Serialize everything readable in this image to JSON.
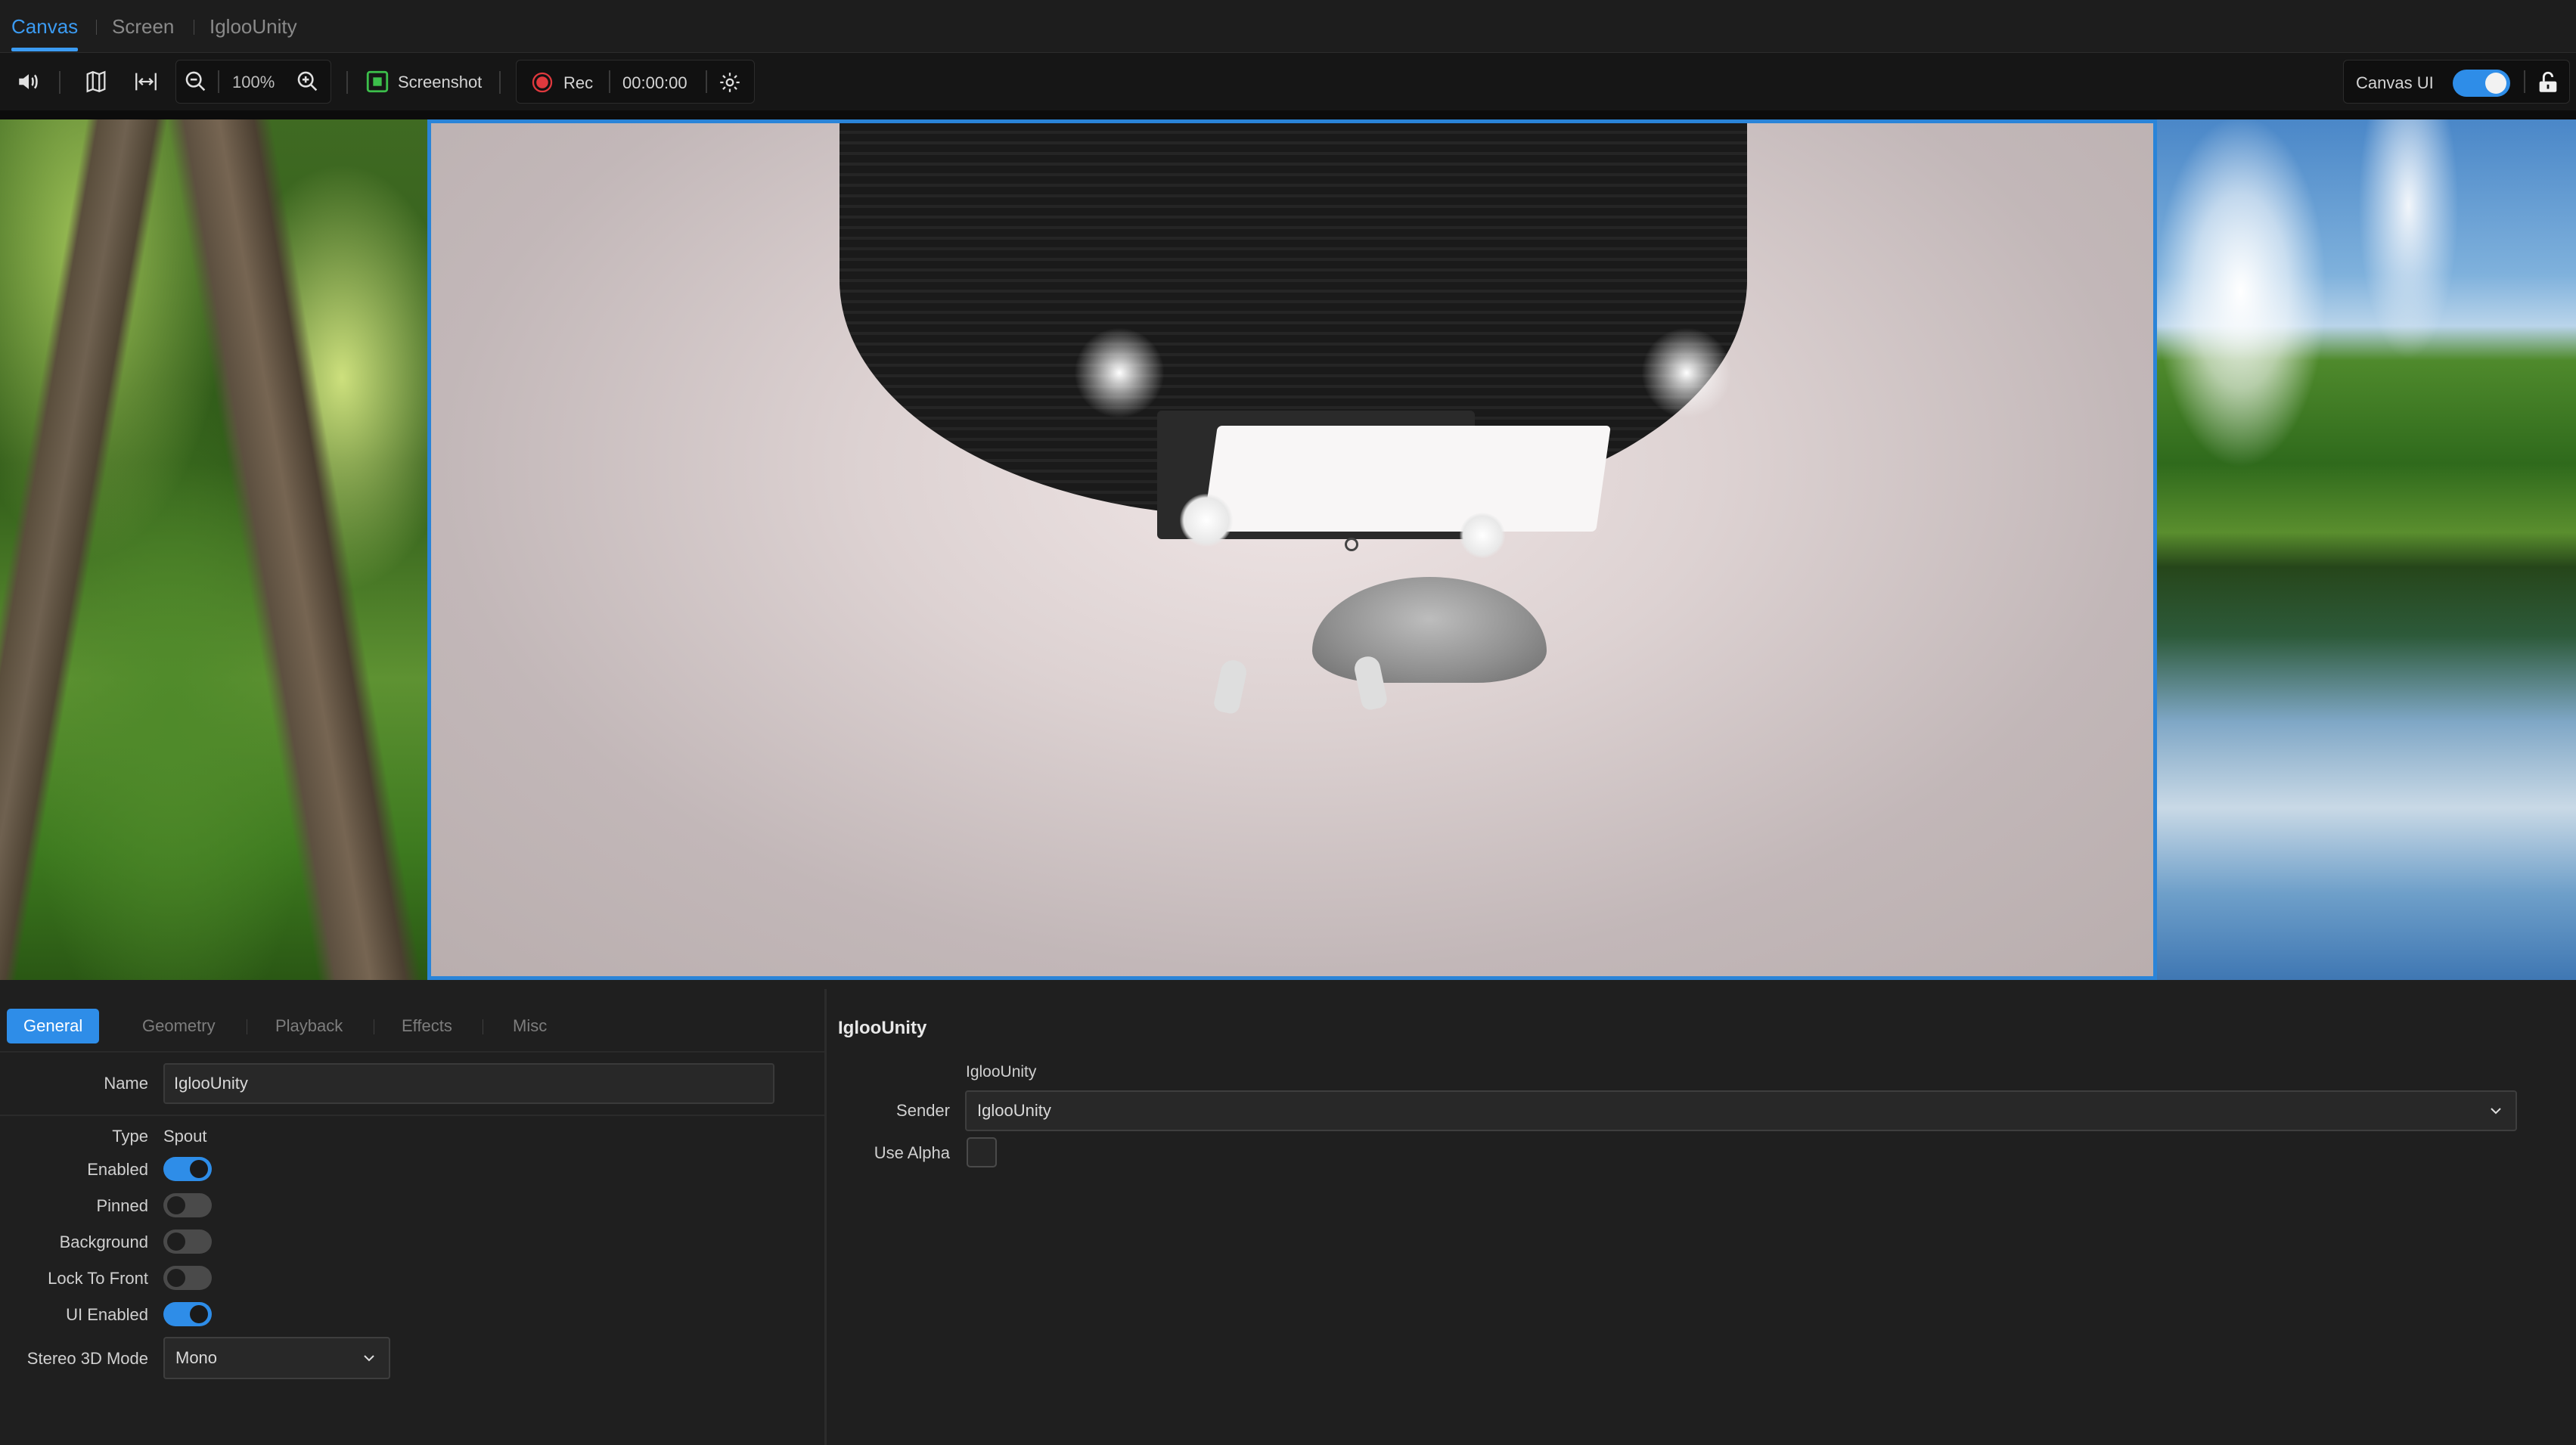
{
  "tabs": {
    "canvas": "Canvas",
    "screen": "Screen",
    "iglooUnity": "IglooUnity"
  },
  "toolbar": {
    "zoom": "100%",
    "screenshot_label": "Screenshot",
    "rec_label": "Rec",
    "timer": "00:00:00",
    "canvas_ui_label": "Canvas UI",
    "canvas_ui_enabled": true
  },
  "colors": {
    "accent": "#2e8de8",
    "selection": "#2a84d8",
    "record": "#e0393e",
    "screenshot": "#3cbf4b"
  },
  "subtabs": {
    "general": "General",
    "geometry": "Geometry",
    "playback": "Playback",
    "effects": "Effects",
    "misc": "Misc"
  },
  "general": {
    "name_label": "Name",
    "name_value": "IglooUnity",
    "type_label": "Type",
    "type_value": "Spout",
    "enabled_label": "Enabled",
    "enabled": true,
    "pinned_label": "Pinned",
    "pinned": false,
    "background_label": "Background",
    "background": false,
    "lock_label": "Lock To Front",
    "lock": false,
    "ui_enabled_label": "UI Enabled",
    "ui_enabled": true,
    "stereo_label": "Stereo 3D Mode",
    "stereo_value": "Mono"
  },
  "detail": {
    "title": "IglooUnity",
    "sender_caption": "IglooUnity",
    "sender_label": "Sender",
    "sender_value": "IglooUnity",
    "use_alpha_label": "Use Alpha",
    "use_alpha": false
  }
}
